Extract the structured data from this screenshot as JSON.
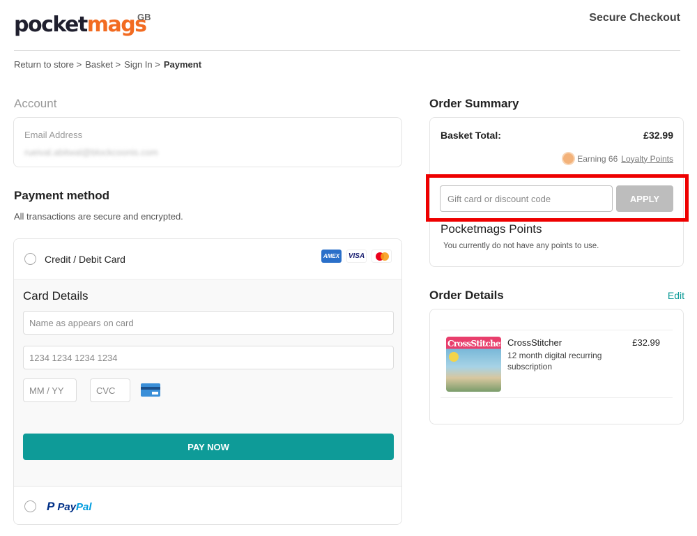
{
  "header": {
    "logo_part1": "pocket",
    "logo_part2": "mags",
    "region": "GB",
    "secure_checkout": "Secure Checkout"
  },
  "breadcrumb": {
    "items": [
      "Return to store >",
      "Basket >",
      "Sign In >"
    ],
    "current": "Payment"
  },
  "account": {
    "title": "Account",
    "email_label": "Email Address",
    "email_value": "rueival.abitwal@blockcoonis.com"
  },
  "payment": {
    "title": "Payment method",
    "subtitle": "All transactions are secure and encrypted.",
    "card_option_label": "Credit / Debit Card",
    "card_logos": [
      "AMEX",
      "VISA",
      "mastercard"
    ],
    "card_details_title": "Card Details",
    "name_placeholder": "Name as appears on card",
    "number_placeholder": "1234 1234 1234 1234",
    "expiry_placeholder": "MM / YY",
    "cvc_placeholder": "CVC",
    "pay_now_label": "PAY NOW",
    "paypal_label_a": "Pay",
    "paypal_label_b": "Pal"
  },
  "summary": {
    "title": "Order Summary",
    "basket_total_label": "Basket Total:",
    "basket_total_value": "£32.99",
    "loyalty_prefix": "Earning 66",
    "loyalty_link": "Loyalty Points",
    "discount_placeholder": "Gift card or discount code",
    "apply_label": "APPLY",
    "points_title": "Pocketmags Points",
    "points_text": "You currently do not have any points to use."
  },
  "order_details": {
    "title": "Order Details",
    "edit_label": "Edit",
    "item": {
      "cover_title": "CrossStitcher",
      "name": "CrossStitcher",
      "description": "12 month digital recurring subscription",
      "price": "£32.99"
    }
  },
  "colors": {
    "brand_orange": "#f26b21",
    "teal": "#0e9b98",
    "highlight_red": "#ee0000"
  }
}
